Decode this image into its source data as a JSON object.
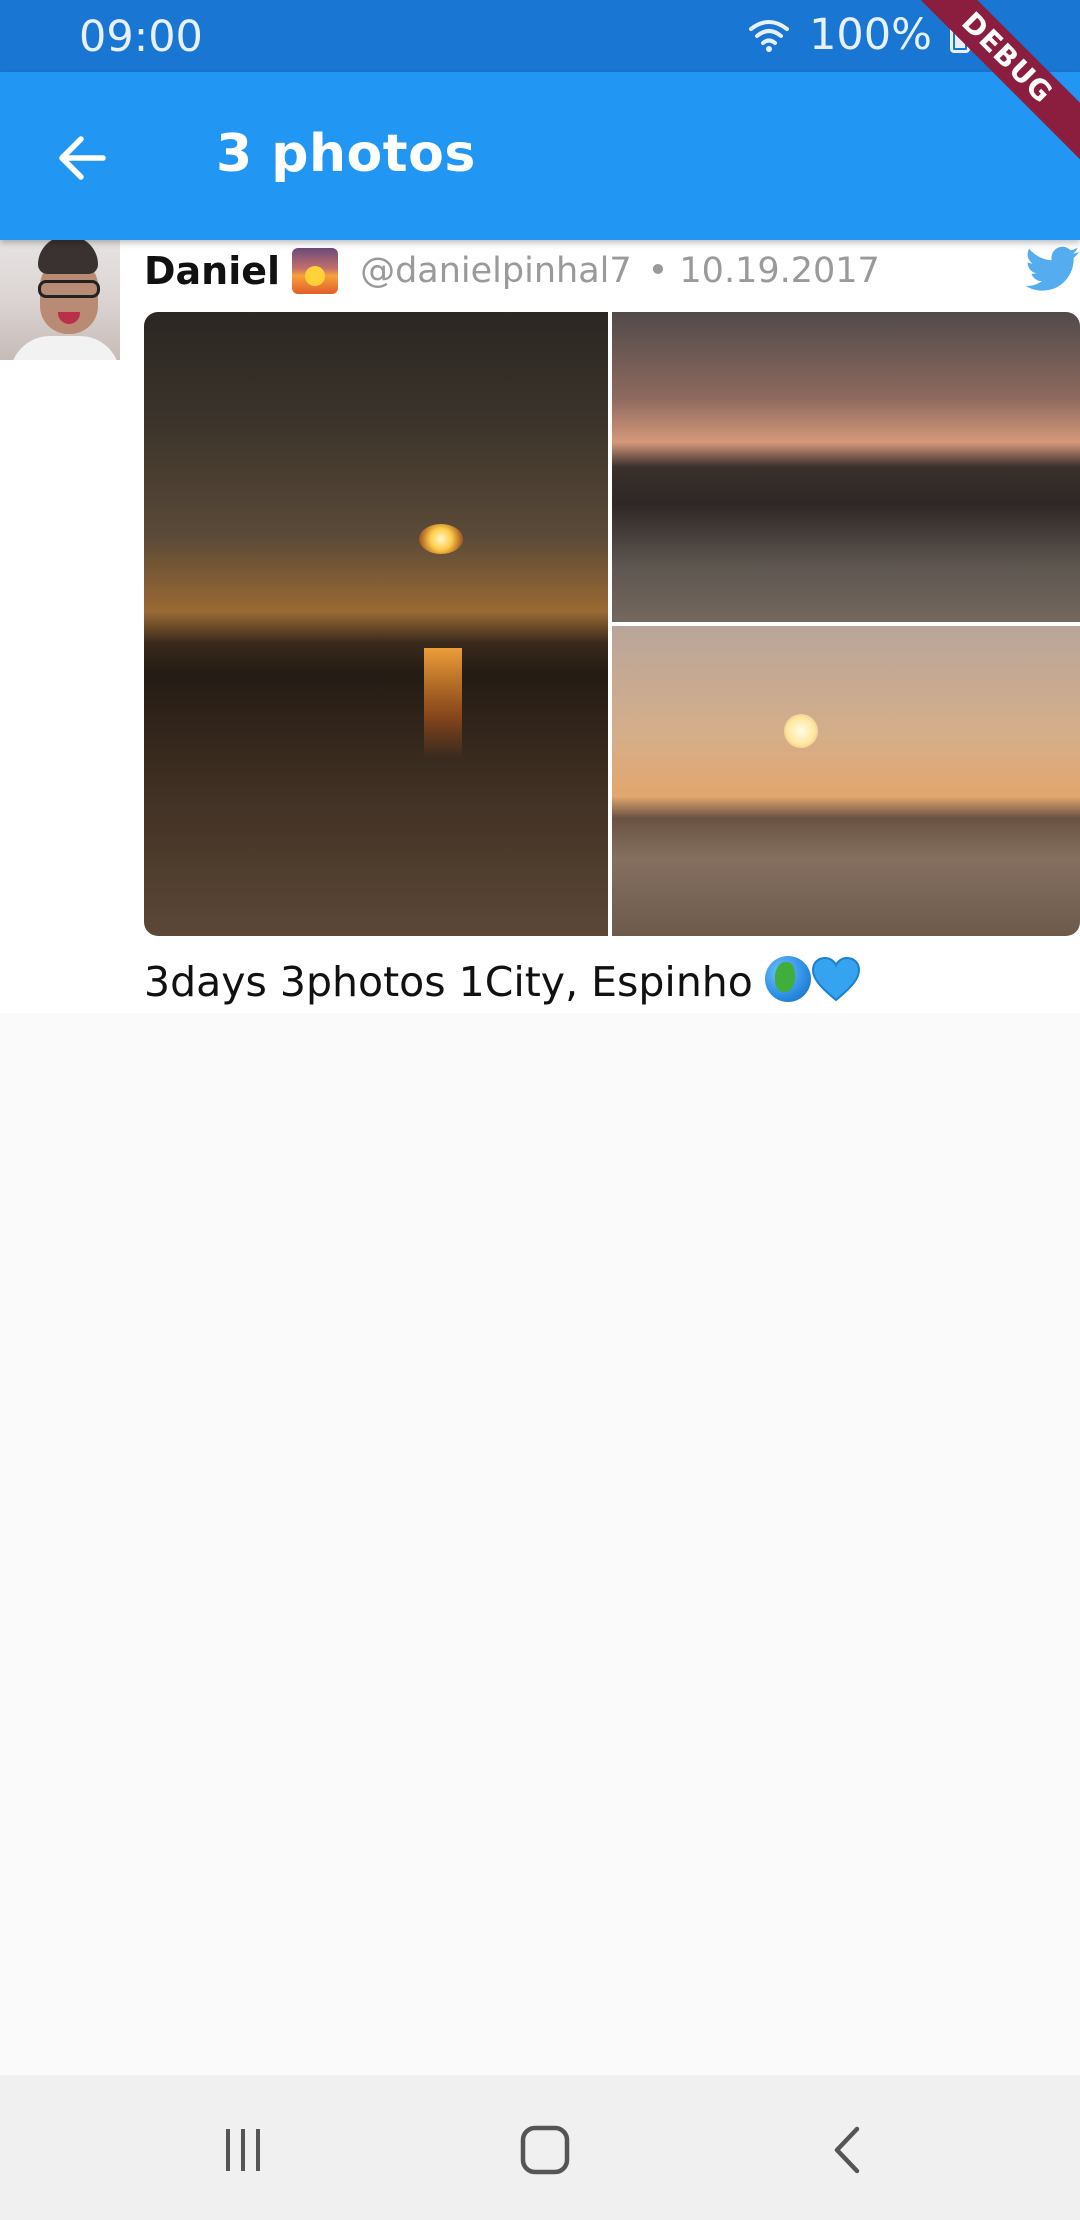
{
  "status_bar": {
    "time": "09:00",
    "battery": "100%"
  },
  "debug_banner": "DEBUG",
  "app_bar": {
    "title": "3 photos"
  },
  "tweet": {
    "name": "Daniel",
    "handle": "@danielpinhal7",
    "date": "• 10.19.2017",
    "text": "3days 3photos 1City, Espinho",
    "photo_count": 3
  },
  "icons": {
    "back": "arrow-left-icon",
    "wifi": "wifi-icon",
    "battery": "battery-icon",
    "twitter": "twitter-bird-icon",
    "name_emoji": "sunrise-emoji",
    "text_emojis": [
      "globe-emoji",
      "blue-heart-emoji"
    ],
    "nav": [
      "recent-apps-icon",
      "home-icon",
      "back-icon"
    ]
  },
  "colors": {
    "status_bar": "#1976d2",
    "app_bar": "#2196f3",
    "twitter_blue": "#55acee",
    "debug": "#8b1e3f"
  }
}
